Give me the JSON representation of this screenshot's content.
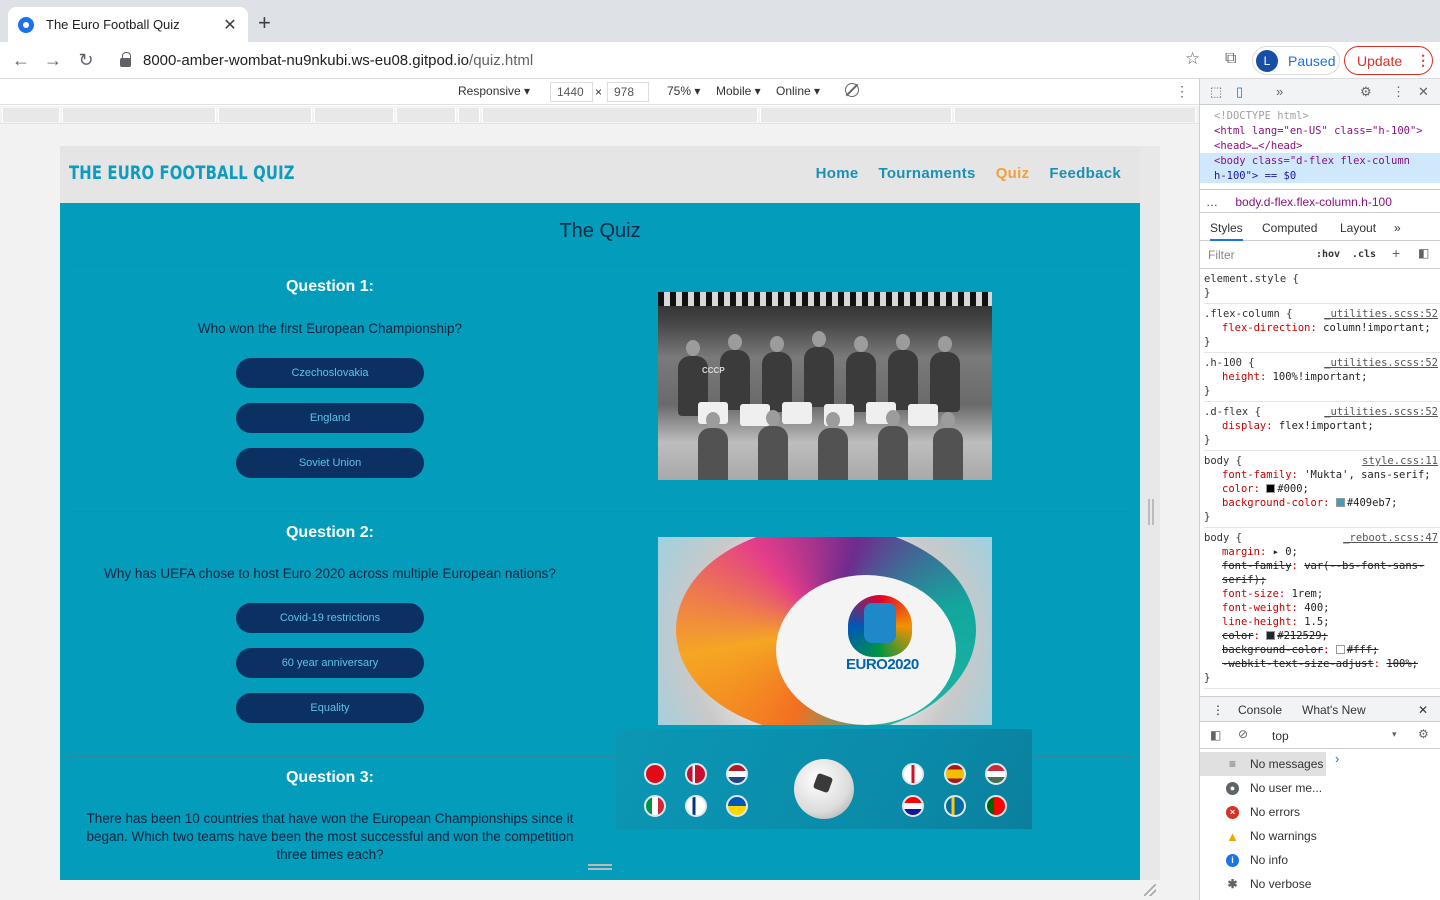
{
  "browser": {
    "tab_title": "The Euro Football Quiz",
    "url_host": "8000-amber-wombat-nu9nkubi.ws-eu08.gitpod.io",
    "url_path": "/quiz.html",
    "profile_initial": "L",
    "profile_status": "Paused",
    "update_label": "Update"
  },
  "device_toolbar": {
    "mode": "Responsive ▾",
    "width": "1440",
    "height": "978",
    "zoom": "75% ▾",
    "device_type": "Mobile ▾",
    "network": "Online ▾",
    "times": "×"
  },
  "site": {
    "logo": "THE EURO FOOTBALL QUIZ",
    "nav": [
      "Home",
      "Tournaments",
      "Quiz",
      "Feedback"
    ],
    "active_nav": "Quiz",
    "page_title": "The Quiz"
  },
  "questions": [
    {
      "heading": "Question 1:",
      "text": "Who won the first European Championship?",
      "answers": [
        "Czechoslovakia",
        "England",
        "Soviet Union"
      ]
    },
    {
      "heading": "Question 2:",
      "text": "Why has UEFA chose to host Euro 2020 across multiple European nations?",
      "answers": [
        "Covid-19 restrictions",
        "60 year anniversary",
        "Equality"
      ]
    },
    {
      "heading": "Question 3:",
      "text": "There has been 10 countries that have won the European Championships since it began. Which two teams have been the most successful and won the competition three times each?"
    }
  ],
  "images": {
    "q1_jersey": "CCCP",
    "q2_logo": "EURO2020"
  },
  "devtools": {
    "doctype": "<!DOCTYPE html>",
    "html_line": "<html lang=\"en-US\" class=\"h-100\">",
    "head_line": "<head>…</head>",
    "body_open": "<body class=\"d-flex flex-column",
    "body_cont": "h-100\"> == $0",
    "breadcrumb": "body.d-flex.flex-column.h-100",
    "tabs": [
      "Styles",
      "Computed",
      "Layout",
      "»"
    ],
    "filter_placeholder": "Filter",
    "hov": ":hov",
    "cls": ".cls",
    "rules": [
      {
        "selector": "element.style {",
        "source": "",
        "props": []
      },
      {
        "selector": ".flex-column {",
        "source": "_utilities.scss:52",
        "props": [
          [
            "flex-direction",
            "column!important;"
          ]
        ]
      },
      {
        "selector": ".h-100 {",
        "source": "_utilities.scss:52",
        "props": [
          [
            "height",
            "100%!important;"
          ]
        ]
      },
      {
        "selector": ".d-flex {",
        "source": "_utilities.scss:52",
        "props": [
          [
            "display",
            "flex!important;"
          ]
        ]
      },
      {
        "selector": "body {",
        "source": "style.css:11",
        "props": [
          [
            "font-family",
            "'Mukta', sans-serif;"
          ],
          [
            "color",
            "#000;"
          ],
          [
            "background-color",
            "#409eb7;"
          ]
        ]
      },
      {
        "selector": "body {",
        "source": "_reboot.scss:47",
        "props": [
          [
            "margin",
            "▸ 0;"
          ],
          [
            "font-family",
            "var(--bs-font-sans-serif);"
          ],
          [
            "font-size",
            "1rem;"
          ],
          [
            "font-weight",
            "400;"
          ],
          [
            "line-height",
            "1.5;"
          ],
          [
            "color",
            "#212529;"
          ],
          [
            "background-color",
            "#fff;"
          ],
          [
            "-webkit-text-size-adjust",
            "100%;"
          ]
        ]
      }
    ],
    "console_tabs": [
      "Console",
      "What's New"
    ],
    "context": "top",
    "messages": [
      "No messages",
      "No user me...",
      "No errors",
      "No warnings",
      "No info",
      "No verbose"
    ]
  },
  "colors": {
    "quiz_bg": "#049cbb",
    "button_bg": "#0b3163",
    "nav_active": "#f0a23a",
    "logo": "#0b9cbf"
  }
}
